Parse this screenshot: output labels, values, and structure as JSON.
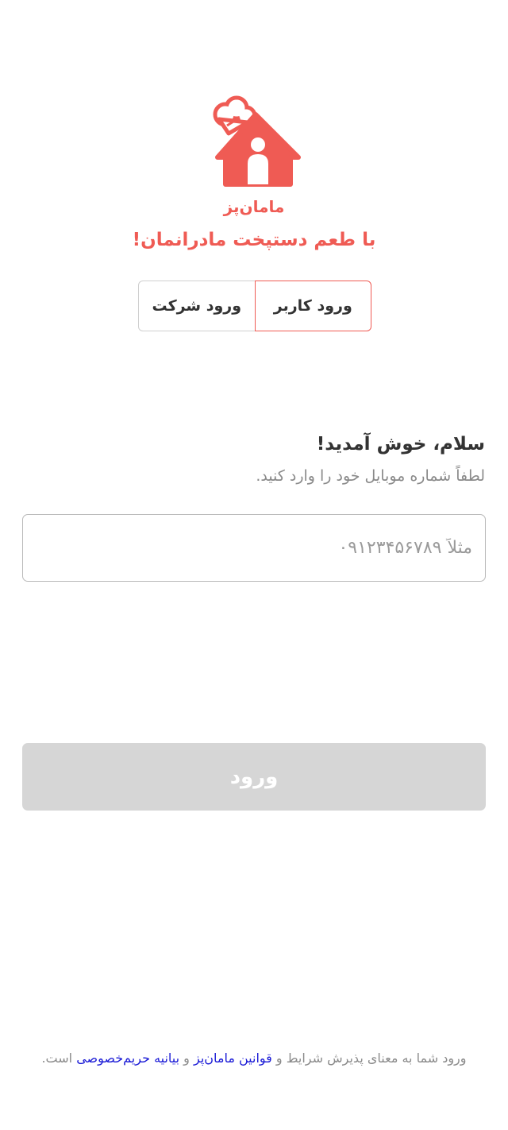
{
  "header": {
    "brand_name": "مامان‌پز",
    "slogan": "با طعم دستپخت مادرانمان!"
  },
  "tabs": [
    {
      "label": "ورود کاربر",
      "active": true
    },
    {
      "label": "ورود شرکت",
      "active": false
    }
  ],
  "login": {
    "greeting": "سلام، خوش آمدید!",
    "instruction": "لطفاً شماره موبایل خود را وارد کنید.",
    "phone_value": "",
    "phone_placeholder": "مثلاً ۰۹۱۲۳۴۵۶۷۸۹",
    "submit_label": "ورود"
  },
  "footer": {
    "text_before": "ورود شما به معنای پذیرش شرایط و ",
    "rules_link": "قوانین مامان‌پز",
    "conjunction": " و ",
    "privacy_link": "بیانیه حریم‌خصوصی",
    "text_after": " است."
  },
  "colors": {
    "accent": "#ef5b54",
    "disabled_button": "#d6d6d6",
    "link": "#1a1ad6"
  }
}
